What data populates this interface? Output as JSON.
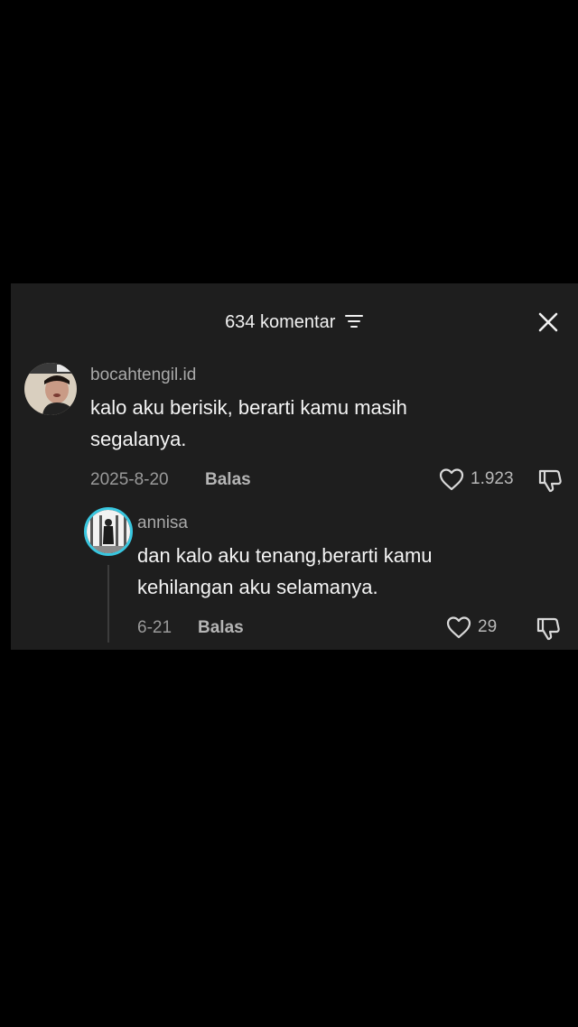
{
  "header": {
    "title": "634 komentar"
  },
  "comments": [
    {
      "username": "bocahtengil.id",
      "text_lines": [
        "kalo aku berisik, berarti kamu masih",
        "segalanya."
      ],
      "date": "2025-8-20",
      "reply_label": "Balas",
      "likes": "1.923"
    },
    {
      "username": "annisa",
      "text_lines": [
        "dan kalo aku tenang,berarti kamu",
        "kehilangan aku selamanya."
      ],
      "date": "6-21",
      "reply_label": "Balas",
      "likes": "29"
    }
  ],
  "icons": {
    "filter": "filter-icon",
    "close": "close-icon",
    "like": "heart-icon",
    "dislike": "thumbs-down-icon"
  },
  "colors": {
    "background": "#000000",
    "panel": "#1e1e1e",
    "story_ring": "#38c7e0"
  }
}
